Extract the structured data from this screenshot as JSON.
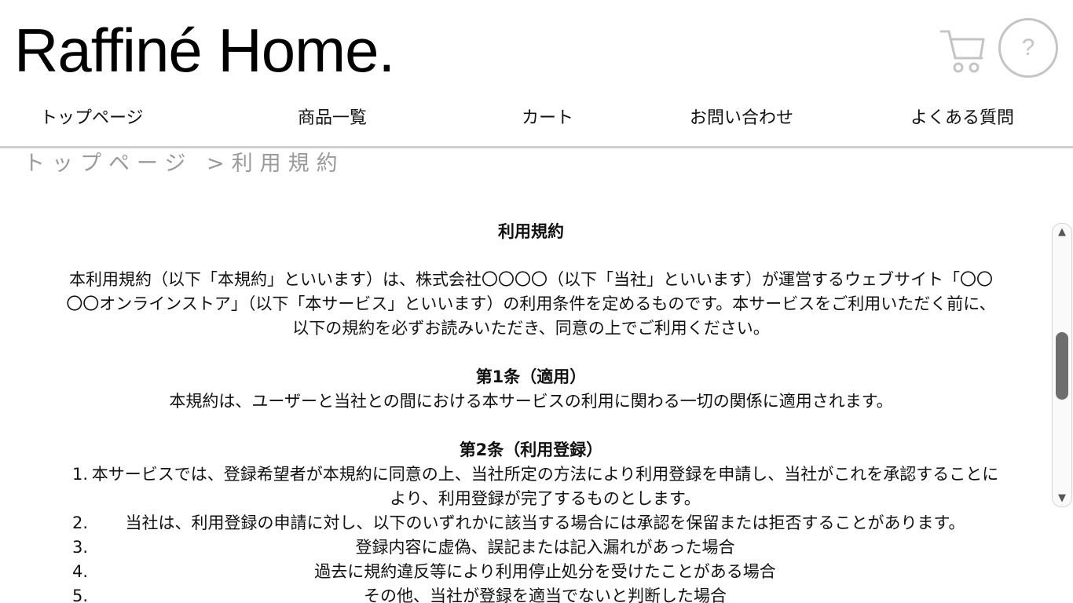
{
  "header": {
    "logo": "Raffiné Home.",
    "cart_icon": "shopping-cart-icon",
    "help_icon": "question-mark-icon",
    "help_label": "?"
  },
  "nav": {
    "items": [
      {
        "label": "トップページ"
      },
      {
        "label": "商品一覧"
      },
      {
        "label": "カート"
      },
      {
        "label": "お問い合わせ"
      },
      {
        "label": "よくある質問"
      }
    ]
  },
  "breadcrumb": {
    "home": "トップページ",
    "separator": " >",
    "current": "利用規約"
  },
  "terms": {
    "title": "利用規約",
    "intro": "本利用規約（以下「本規約」といいます）は、株式会社〇〇〇〇（以下「当社」といいます）が運営するウェブサイト「〇〇〇〇オンラインストア」（以下「本サービス」といいます）の利用条件を定めるものです。本サービスをご利用いただく前に、以下の規約を必ずお読みいただき、同意の上でご利用ください。",
    "article1": {
      "heading": "第1条（適用）",
      "body": "本規約は、ユーザーと当社との間における本サービスの利用に関わる一切の関係に適用されます。"
    },
    "article2": {
      "heading": "第2条（利用登録）",
      "items": [
        {
          "num": "1.",
          "text": "本サービスでは、登録希望者が本規約に同意の上、当社所定の方法により利用登録を申請し、当社がこれを承認することにより、利用登録が完了するものとします。"
        },
        {
          "num": "2.",
          "text": "当社は、利用登録の申請に対し、以下のいずれかに該当する場合には承認を保留または拒否することがあります。"
        },
        {
          "num": "3.",
          "text": "登録内容に虚偽、誤記または記入漏れがあった場合"
        },
        {
          "num": "4.",
          "text": "過去に規約違反等により利用停止処分を受けたことがある場合"
        },
        {
          "num": "5.",
          "text": "その他、当社が登録を適当でないと判断した場合"
        }
      ]
    }
  },
  "scrollbar": {
    "up_arrow": "▲",
    "down_arrow": "▼",
    "position": 0.35
  },
  "colors": {
    "nav_border": "#cfcfcf",
    "breadcrumb": "#9a9a9a",
    "icon_gray": "#c4c4c4"
  }
}
